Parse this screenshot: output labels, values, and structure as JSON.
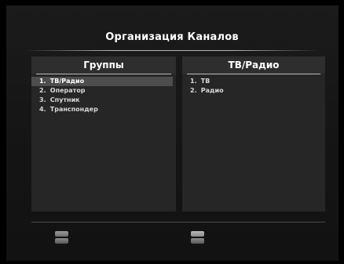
{
  "screen": {
    "title": "Организация Каналов"
  },
  "groups_panel": {
    "header": "Группы",
    "selected_index": 0,
    "items": [
      {
        "num": "1.",
        "label": "ТВ/Радио"
      },
      {
        "num": "2.",
        "label": "Оператор"
      },
      {
        "num": "3.",
        "label": "Спутник"
      },
      {
        "num": "4.",
        "label": "Транспондер"
      }
    ]
  },
  "content_panel": {
    "header": "ТВ/Радио",
    "items": [
      {
        "num": "1.",
        "label": "ТВ"
      },
      {
        "num": "2.",
        "label": "Радио"
      }
    ]
  },
  "footer": {
    "icons": [
      "remote-key-icon",
      "remote-key-icon"
    ]
  },
  "colors": {
    "background": "#000000",
    "panel": "#262626",
    "highlight": "#4d4d4d",
    "text": "#ffffff"
  }
}
